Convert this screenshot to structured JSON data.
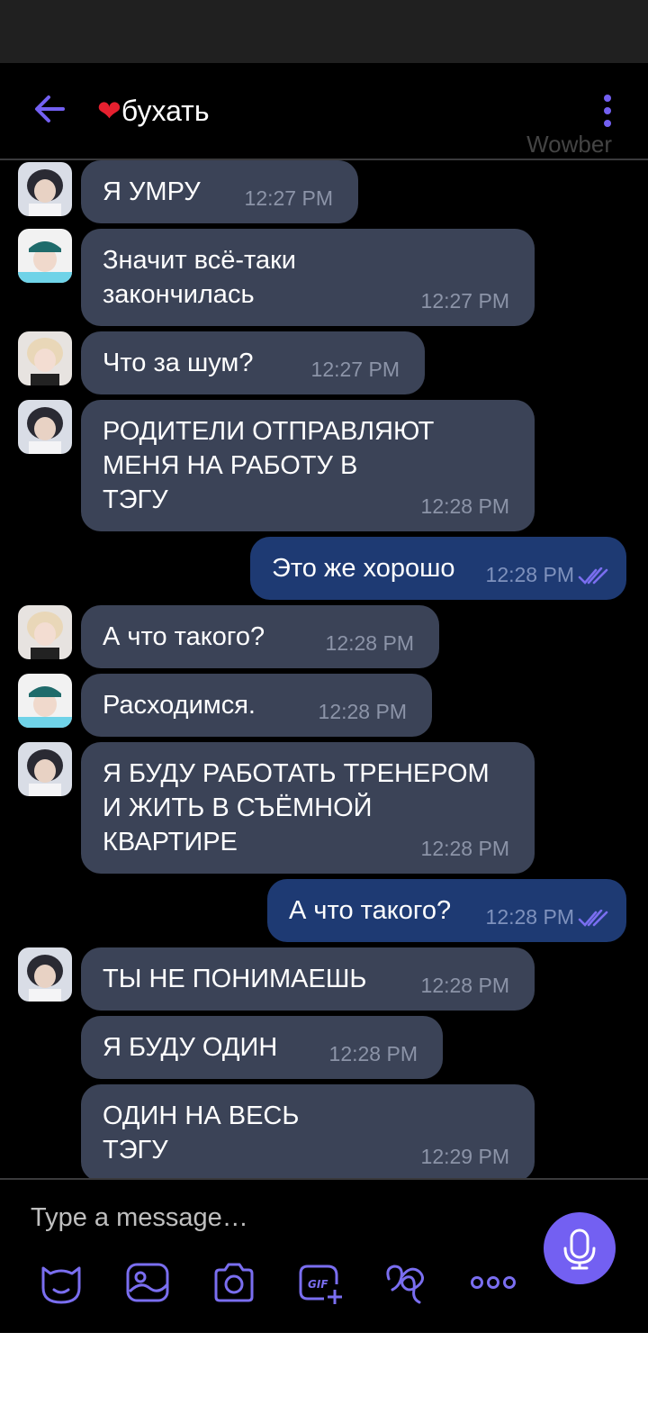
{
  "header": {
    "title_heart": "❤",
    "title": "бухать",
    "watermark": "Wowber"
  },
  "messages": [
    {
      "text": "Я УМРУ",
      "time": "12:27 PM"
    },
    {
      "text": "Значит всё-таки\nзакончилась",
      "time": "12:27 PM"
    },
    {
      "text": "Что за шум?",
      "time": "12:27 PM"
    },
    {
      "text": "РОДИТЕЛИ ОТПРАВЛЯЮТ\nМЕНЯ НА РАБОТУ В\nТЭГУ",
      "time": "12:28 PM"
    },
    {
      "text": "Это же хорошо",
      "time": "12:28 PM"
    },
    {
      "text": "А что такого?",
      "time": "12:28 PM"
    },
    {
      "text": "Расходимся.",
      "time": "12:28 PM"
    },
    {
      "text": "Я БУДУ РАБОТАТЬ ТРЕНЕРОМ\nИ ЖИТЬ В СЪЁМНОЙ\nКВАРТИРЕ",
      "time": "12:28 PM"
    },
    {
      "text": "А что такого?",
      "time": "12:28 PM"
    },
    {
      "text": "ТЫ НЕ ПОНИМАЕШЬ",
      "time": "12:28 PM"
    },
    {
      "text": "Я БУДУ ОДИН",
      "time": "12:28 PM"
    },
    {
      "text": "ОДИН НА ВЕСЬ\nТЭГУ",
      "time": "12:29 PM"
    }
  ],
  "composer": {
    "placeholder": "Type a message…"
  },
  "colors": {
    "accent": "#7360f2",
    "incoming_bubble": "#3b4357",
    "outgoing_bubble": "#1e3a73",
    "heart": "#e6202f"
  }
}
